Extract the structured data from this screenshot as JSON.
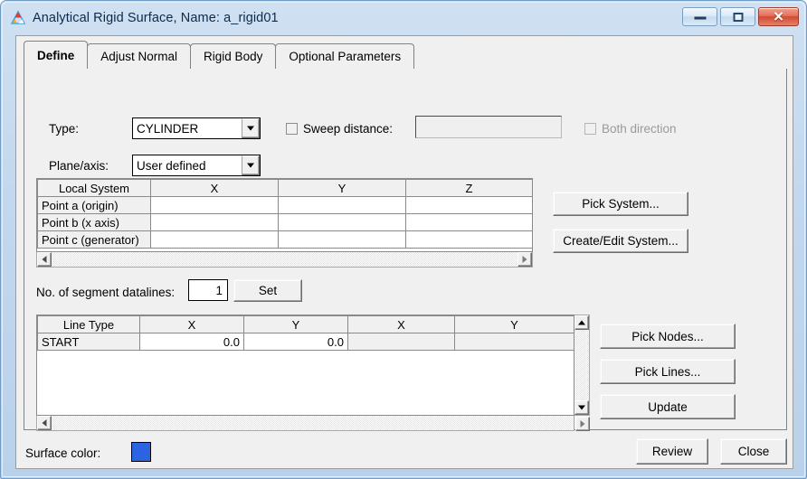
{
  "window": {
    "title": "Analytical Rigid Surface,  Name: a_rigid01",
    "minimize_label": "Minimize",
    "maximize_label": "Maximize",
    "close_label": "✕"
  },
  "tabs": [
    {
      "label": "Define",
      "active": true
    },
    {
      "label": "Adjust Normal",
      "active": false
    },
    {
      "label": "Rigid Body",
      "active": false
    },
    {
      "label": "Optional Parameters",
      "active": false
    }
  ],
  "define": {
    "type_label": "Type:",
    "type_value": "CYLINDER",
    "plane_axis_label": "Plane/axis:",
    "plane_axis_value": "User defined",
    "sweep_distance_label": "Sweep distance:",
    "sweep_distance_value": "",
    "both_direction_label": "Both direction",
    "segment_datalines_label": "No. of segment datalines:",
    "segment_datalines_value": "1",
    "set_button": "Set"
  },
  "local_system_table": {
    "headers": [
      "Local System",
      "X",
      "Y",
      "Z"
    ],
    "rows": [
      {
        "label": "Point a (origin)",
        "cells": [
          "",
          "",
          ""
        ]
      },
      {
        "label": "Point b (x axis)",
        "cells": [
          "",
          "",
          ""
        ]
      },
      {
        "label": "Point c (generator)",
        "cells": [
          "",
          "",
          ""
        ]
      }
    ]
  },
  "local_system_buttons": [
    {
      "label": "Pick System..."
    },
    {
      "label": "Create/Edit System..."
    }
  ],
  "line_table": {
    "headers": [
      "Line Type",
      "X",
      "Y",
      "X",
      "Y"
    ],
    "rows": [
      {
        "type": "START",
        "cells": [
          "0.0",
          "0.0",
          "",
          ""
        ]
      }
    ]
  },
  "line_buttons": [
    {
      "label": "Pick Nodes..."
    },
    {
      "label": "Pick Lines..."
    },
    {
      "label": "Update"
    }
  ],
  "footer": {
    "surface_color_label": "Surface color:",
    "surface_color": "#2c63e0",
    "review_button": "Review",
    "close_button": "Close"
  }
}
